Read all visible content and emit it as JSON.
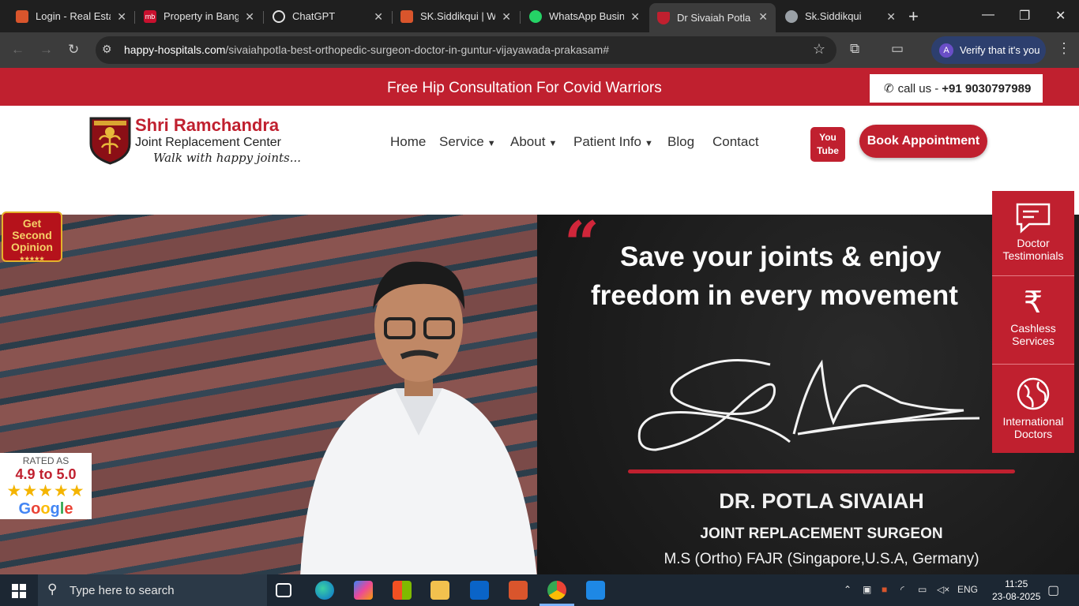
{
  "browser": {
    "tabs": [
      {
        "title": "Login - Real Estat",
        "icon": "pro-icon",
        "color": "#d9552c"
      },
      {
        "title": "Property in Bang",
        "icon": "mb-icon",
        "color": "#c8102e"
      },
      {
        "title": "ChatGPT",
        "icon": "chatgpt-icon",
        "color": "#e3e3e3"
      },
      {
        "title": "SK.Siddikqui | We",
        "icon": "pro-icon",
        "color": "#d9552c"
      },
      {
        "title": "WhatsApp Busine",
        "icon": "whatsapp-icon",
        "color": "#25d366"
      },
      {
        "title": "Dr Sivaiah Potla -",
        "icon": "site-icon",
        "color": "#c0202f"
      },
      {
        "title": "Sk.Siddikqui",
        "icon": "globe-icon",
        "color": "#9aa0a6"
      }
    ],
    "url_host": "happy-hospitals.com",
    "url_path": "/sivaiahpotla-best-orthopedic-surgeon-doctor-in-guntur-vijayawada-prakasam#",
    "verify_label": "Verify that it's you",
    "avatar_letter": "A"
  },
  "page": {
    "topbar_message": "Free Hip Consultation For Covid Warriors",
    "call_label": "call us - ",
    "call_number": "+91 9030797989",
    "brand_name": "Shri Ramchandra",
    "brand_sub": "Joint Replacement Center",
    "brand_tagline": "Walk with happy joints...",
    "menu": [
      {
        "label": "Home",
        "dropdown": false
      },
      {
        "label": "Service",
        "dropdown": true
      },
      {
        "label": "About",
        "dropdown": true
      },
      {
        "label": "Patient Info",
        "dropdown": true
      },
      {
        "label": "Blog",
        "dropdown": false
      },
      {
        "label": "Contact",
        "dropdown": false
      }
    ],
    "youtube_label": "You Tube",
    "book_label": "Book Appointment",
    "hero": {
      "tagline_line1": "Save your joints & enjoy",
      "tagline_line2": "freedom in every movement",
      "doctor_name": "DR. POTLA SIVAIAH",
      "doctor_role": "JOINT REPLACEMENT SURGEON",
      "doctor_quals": "M.S (Ortho) FAJR (Singapore,U.S.A, Germany)"
    },
    "second_opinion": {
      "line1": "Get",
      "line2": "Second",
      "line3": "Opinion"
    },
    "rating": {
      "label": "RATED AS",
      "value": "4.9 to 5.0",
      "stars": "★★★★★",
      "brand": "Google"
    },
    "side_buttons": [
      {
        "line1": "Doctor",
        "line2": "Testimonials",
        "icon": "chat-icon"
      },
      {
        "line1": "Cashless",
        "line2": "Services",
        "icon": "rupee-icon"
      },
      {
        "line1": "International",
        "line2": "Doctors",
        "icon": "globe-icon"
      }
    ]
  },
  "taskbar": {
    "search_placeholder": "Type here to search",
    "language": "ENG",
    "time": "11:25",
    "date": "23-08-2025"
  },
  "colors": {
    "brand_red": "#c0202f",
    "chrome_dark": "#1f1f1f",
    "taskbar": "#1c2733"
  }
}
